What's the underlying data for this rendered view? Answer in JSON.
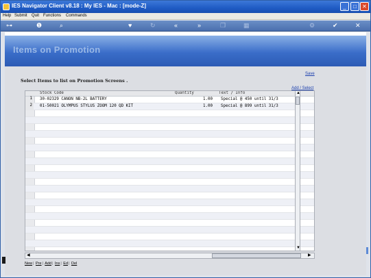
{
  "window": {
    "title": "IES Navigator Client v8.18 : My IES - Mac :       [mode-Z]",
    "buttons": {
      "minimize": "_",
      "maximize": "□",
      "close": "✕"
    }
  },
  "menu": {
    "items": [
      "Help",
      "Submit",
      "Quit",
      "Functions",
      "Commands"
    ]
  },
  "toolbar": {
    "icons": [
      "key-icon",
      "info-icon",
      "search-icon",
      "heart-icon",
      "refresh-icon",
      "rewind-icon",
      "forward-icon",
      "copy-icon",
      "table-icon",
      "gear-icon",
      "ok-icon",
      "close-icon"
    ],
    "glyphs": [
      "⊶",
      "❶",
      "⌕",
      "♥",
      "↻",
      "«",
      "»",
      "❐",
      "▦",
      "⚙",
      "✔",
      "✕"
    ]
  },
  "banner": {
    "title": "Items on Promotion"
  },
  "links": {
    "save": "Save",
    "add_select": "Add / Select"
  },
  "heading": "Select Items to list on Promotion Screens .",
  "grid": {
    "columns": [
      "Stock Code",
      "Quantity",
      "Text / Info"
    ],
    "rows": [
      {
        "num": "1",
        "code": "30-02329 CANON NB-2L BATTERY",
        "quantity": "1.00",
        "info": "Special @ 450 until 31/3"
      },
      {
        "num": "2",
        "code": "01-50021 OLYMPUS STYLUS ZOOM 120 QD KIT",
        "quantity": "1.00",
        "info": "Special @ 899 until 31/3"
      }
    ]
  },
  "bottombar": {
    "items": [
      "New",
      "Pre",
      "Add",
      "Ins",
      "Ed",
      "Del"
    ]
  },
  "colors": {
    "titlebar": "#1f5bc4",
    "banner": "#3a6dc9",
    "link": "#1b3fae",
    "grid_alt": "#eef0f6"
  }
}
